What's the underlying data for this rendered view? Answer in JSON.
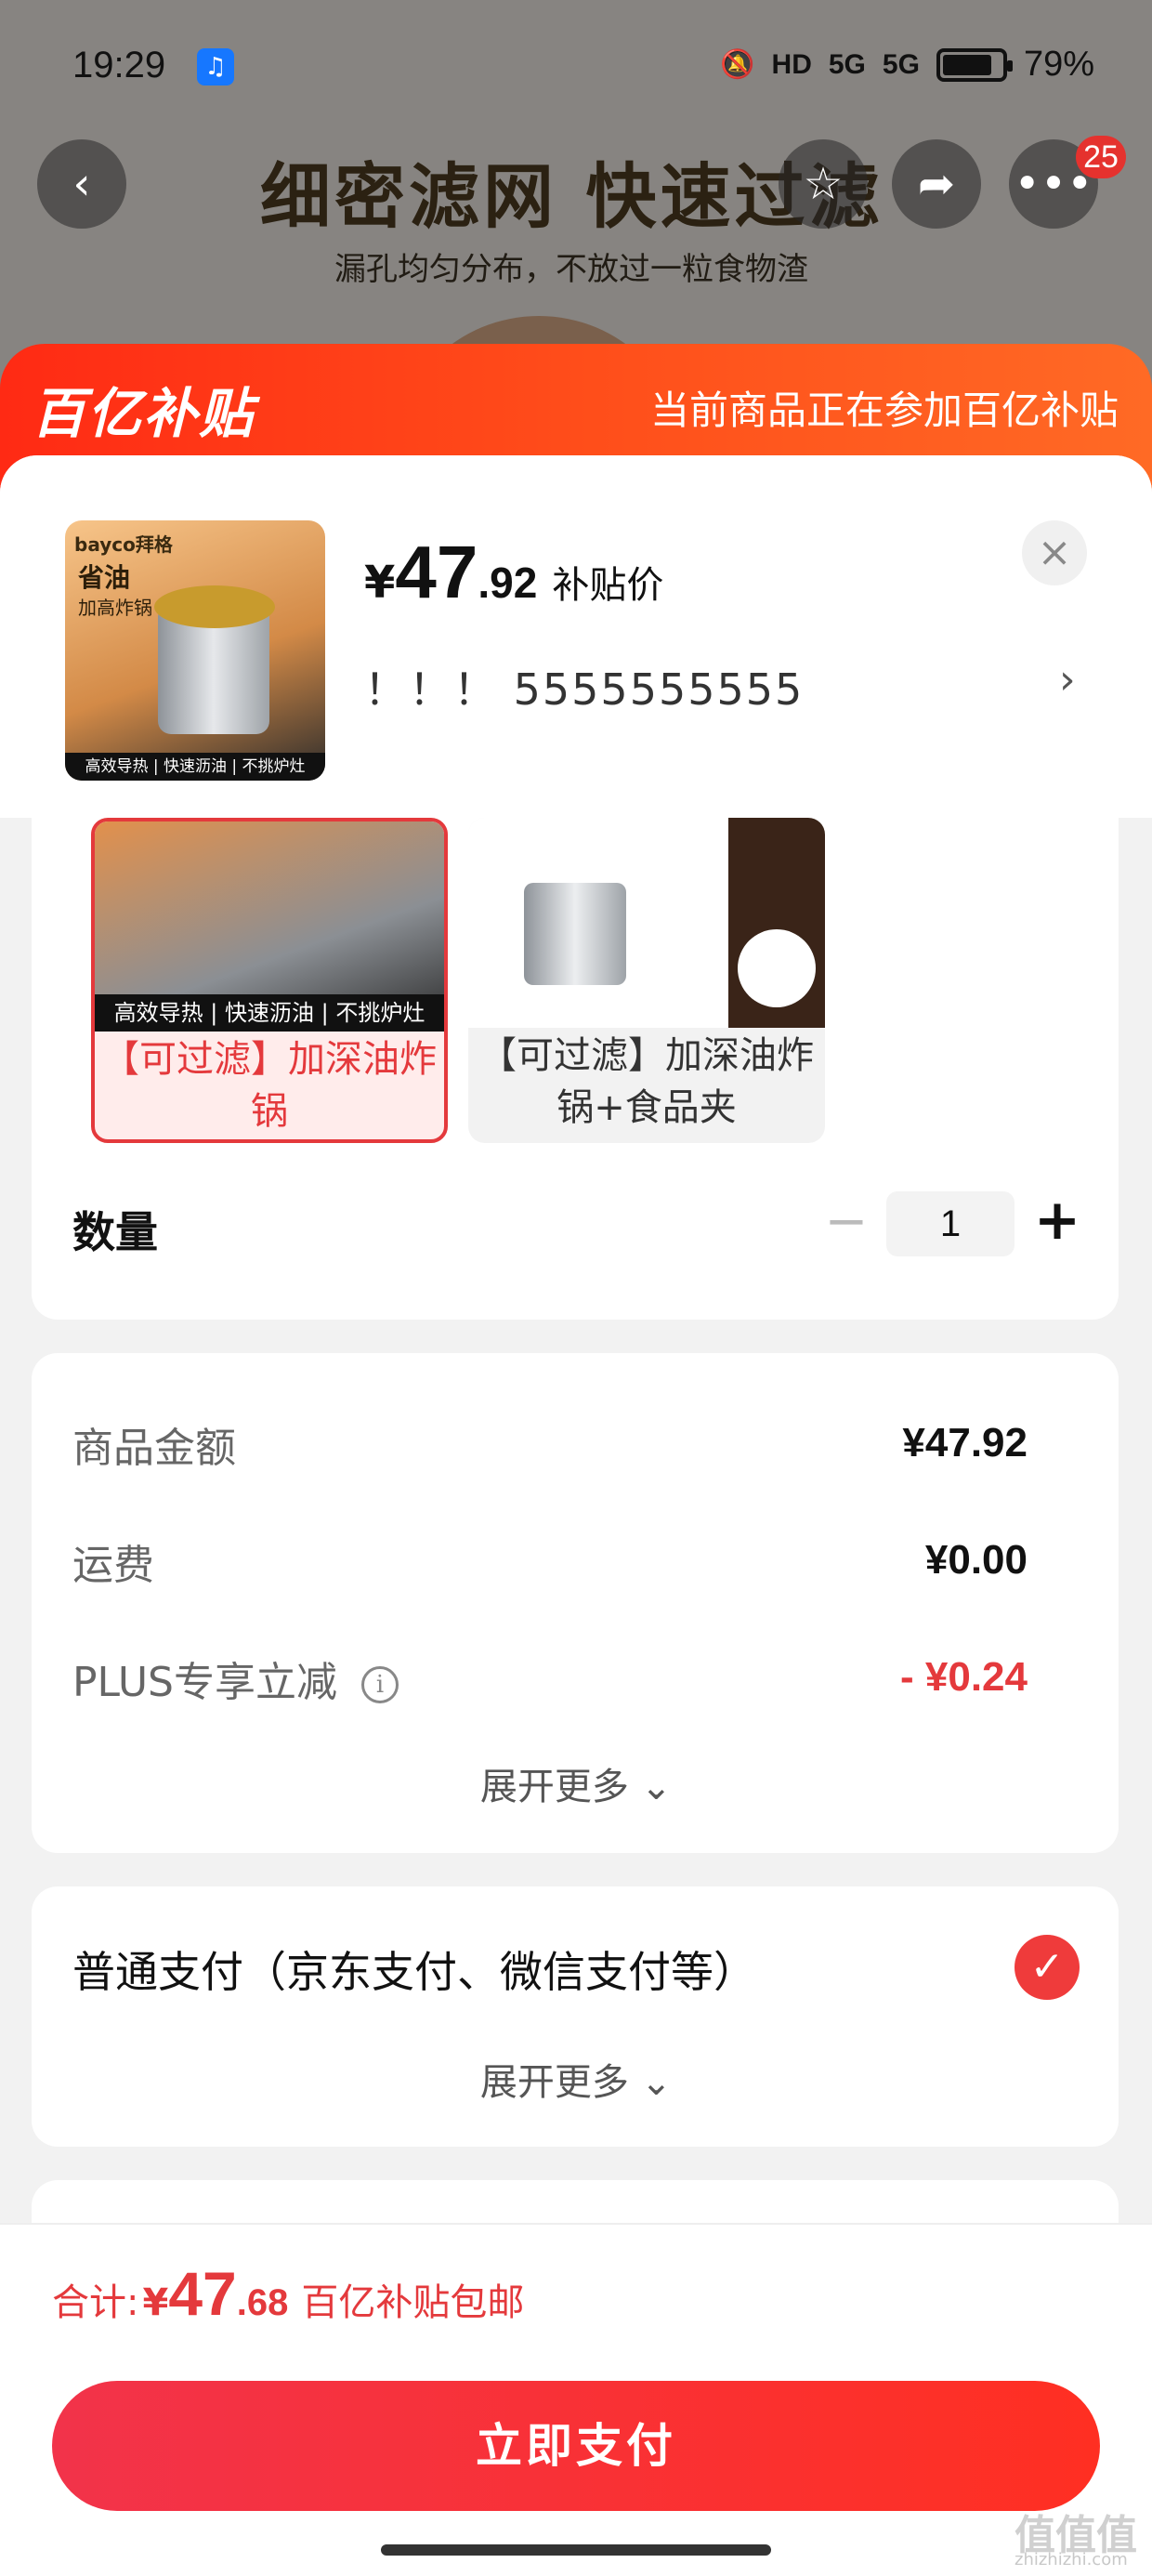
{
  "status_bar": {
    "time": "19:29",
    "signal1": "5G",
    "signal2": "5G",
    "hd": "HD",
    "battery": "79%"
  },
  "background_page": {
    "title": "细密滤网 快速过滤",
    "subtitle": "漏孔均匀分布，不放过一粒食物渣",
    "cart_badge": "25"
  },
  "banner": {
    "logo": "百亿补贴",
    "info": "当前商品正在参加百亿补贴",
    "color": "#ff4d1a"
  },
  "product": {
    "thumb_brand": "bayco拜格",
    "thumb_tag1": "省油",
    "thumb_tag2": "加高炸锅",
    "thumb_caption": "高效导热 | 快速沥油 | 不挑炉灶",
    "price_symbol": "¥",
    "price_int": "47",
    "price_dec": ".92",
    "price_label": "补贴价",
    "spec": "！！！  5555555555"
  },
  "options": [
    {
      "label": "【可过滤】加深油炸锅",
      "caption": "高效导热 | 快速沥油 | 不挑炉灶",
      "selected": true
    },
    {
      "label": "【可过滤】加深油炸锅+食品夹",
      "selected": false
    }
  ],
  "quantity": {
    "label": "数量",
    "value": "1"
  },
  "fees": {
    "goods_label": "商品金额",
    "goods_value": "¥47.92",
    "shipping_label": "运费",
    "shipping_value": "¥0.00",
    "plus_label": "PLUS专享立减",
    "plus_value": "- ¥0.24",
    "expand": "展开更多"
  },
  "payment": {
    "method": "普通支付（京东支付、微信支付等）",
    "expand": "展开更多"
  },
  "footer": {
    "total_prefix": "合计:",
    "total_yen": "¥",
    "total_int": "47",
    "total_dec": ".68",
    "total_note": "百亿补贴包邮",
    "pay_button": "立即支付",
    "accent": "#e4393c"
  },
  "watermark": {
    "text": "值值值",
    "sub": "zhizhizhi.com"
  }
}
